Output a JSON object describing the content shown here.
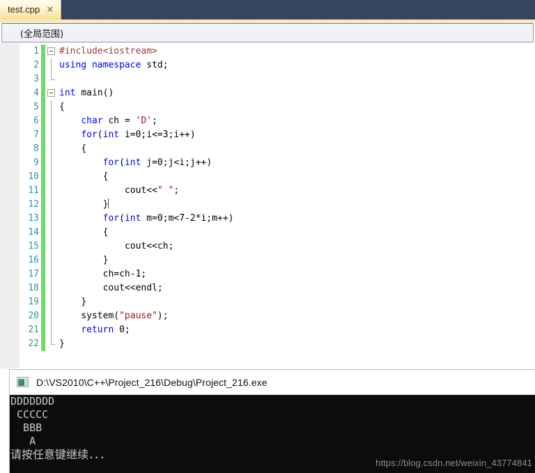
{
  "window": {
    "tab": {
      "title": "test.cpp",
      "close_icon": "close-icon",
      "close_glyph": "✕"
    }
  },
  "scope_bar": {
    "scope": "(全局范围)"
  },
  "editor": {
    "language": "cpp",
    "lines": [
      {
        "no": "1",
        "text": "#include<iostream>"
      },
      {
        "no": "2",
        "text": "using namespace std;"
      },
      {
        "no": "3",
        "text": ""
      },
      {
        "no": "4",
        "text": "int main()"
      },
      {
        "no": "5",
        "text": "{"
      },
      {
        "no": "6",
        "text": "    char ch = 'D';"
      },
      {
        "no": "7",
        "text": "    for(int i=0;i<=3;i++)"
      },
      {
        "no": "8",
        "text": "    {"
      },
      {
        "no": "9",
        "text": "        for(int j=0;j<i;j++)"
      },
      {
        "no": "10",
        "text": "        {"
      },
      {
        "no": "11",
        "text": "            cout<<\" \";"
      },
      {
        "no": "12",
        "text": "        }"
      },
      {
        "no": "13",
        "text": "        for(int m=0;m<7-2*i;m++)"
      },
      {
        "no": "14",
        "text": "        {"
      },
      {
        "no": "15",
        "text": "            cout<<ch;"
      },
      {
        "no": "16",
        "text": "        }"
      },
      {
        "no": "17",
        "text": "        ch=ch-1;"
      },
      {
        "no": "18",
        "text": "        cout<<endl;"
      },
      {
        "no": "19",
        "text": "    }"
      },
      {
        "no": "20",
        "text": "    system(\"pause\");"
      },
      {
        "no": "21",
        "text": "    return 0;"
      },
      {
        "no": "22",
        "text": "}"
      }
    ],
    "cursor_line": "12"
  },
  "console": {
    "title_path": "D:\\VS2010\\C++\\Project_216\\Debug\\Project_216.exe",
    "icon": "console-window-icon",
    "output": [
      "DDDDDDD",
      " CCCCC",
      "  BBB",
      "   A",
      "请按任意键继续．．．"
    ]
  },
  "watermark": {
    "text": "https://blog.csdn.net/weixin_43774841"
  },
  "colors": {
    "tabstrip_bg": "#33435f",
    "tab_gold": "#fff6d2",
    "accent_underline": "#fce9ad",
    "keyword_blue": "#0000ff",
    "string_red": "#a31515",
    "preprocessor_red": "#9a3b3b",
    "linenumber_teal": "#2b91af",
    "changebar_green": "#6ed96e",
    "console_bg": "#0c0c0c",
    "console_fg": "#ccc9c2"
  }
}
